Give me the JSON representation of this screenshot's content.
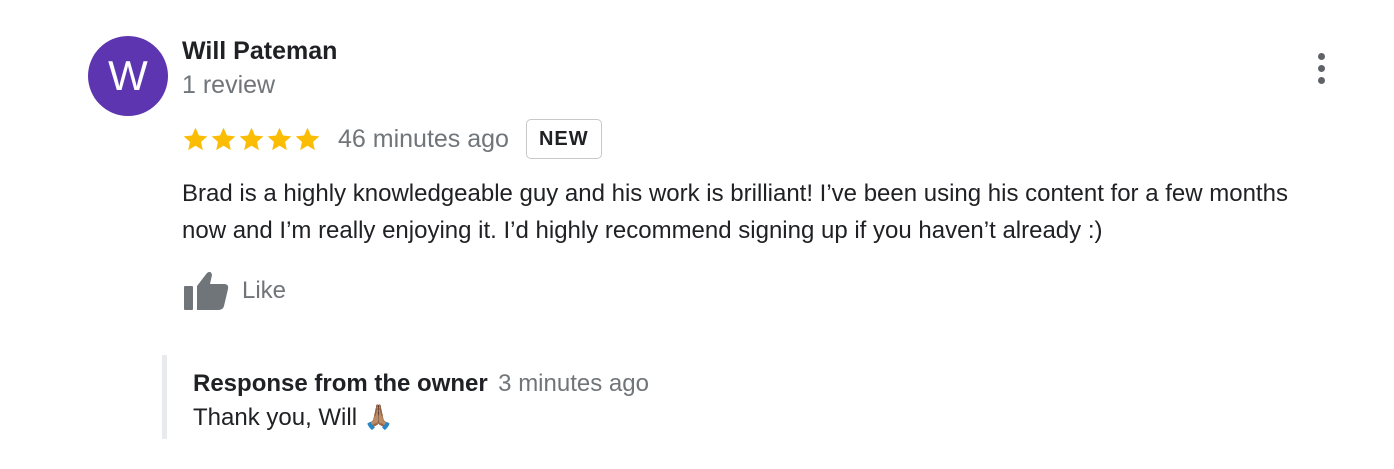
{
  "review": {
    "avatar_initial": "W",
    "avatar_color": "#5e35b1",
    "reviewer_name": "Will Pateman",
    "review_count": "1 review",
    "rating": 5,
    "rating_max": 5,
    "star_color": "#fbbc04",
    "time_ago": "46 minutes ago",
    "badge": "NEW",
    "text": "Brad is a highly knowledgeable guy and his work  is brilliant! I’ve been using his content for a few months now and I’m really enjoying it. I’d highly recommend signing up if you haven’t already :)",
    "like_label": "Like",
    "more_icon": "more-vert-icon",
    "like_icon": "thumb-up-icon"
  },
  "owner_response": {
    "title": "Response from the owner",
    "time_ago": "3 minutes ago",
    "text": "Thank you, Will 🙏🏽"
  }
}
